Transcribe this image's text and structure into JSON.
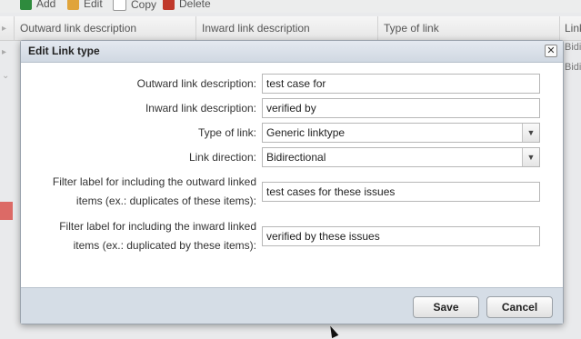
{
  "toolbar": {
    "add_label": "Add",
    "edit_label": "Edit",
    "copy_label": "Copy",
    "delete_label": "Delete"
  },
  "grid": {
    "columns": [
      "Outward link description",
      "Inward link description",
      "Type of link",
      "Link"
    ],
    "row_peek": [
      "Bidi",
      "Bidi"
    ]
  },
  "dialog": {
    "title": "Edit Link type",
    "close_glyph": "✕",
    "fields": {
      "outward_label": "Outward link description:",
      "outward_value": "test case for",
      "inward_label": "Inward link description:",
      "inward_value": "verified by",
      "type_label": "Type of link:",
      "type_value": "Generic linktype",
      "direction_label": "Link direction:",
      "direction_value": "Bidirectional",
      "filter_out_label_1": "Filter label for including the outward linked",
      "filter_out_label_2": "items (ex.: duplicates of these items):",
      "filter_out_value": "test cases for these issues",
      "filter_in_label_1": "Filter label for including the inward linked",
      "filter_in_label_2": "items (ex.: duplicated by these items):",
      "filter_in_value": "verified by these issues"
    },
    "save_label": "Save",
    "cancel_label": "Cancel"
  },
  "colors": {
    "dialog_header": "#d0d8e2",
    "dialog_footer": "#d5dde6",
    "delete_icon": "#c0392b",
    "add_icon": "#2e8b3d"
  },
  "icons": [
    "add-icon",
    "edit-icon",
    "copy-icon",
    "delete-icon",
    "close-icon",
    "chevron-down-icon"
  ]
}
